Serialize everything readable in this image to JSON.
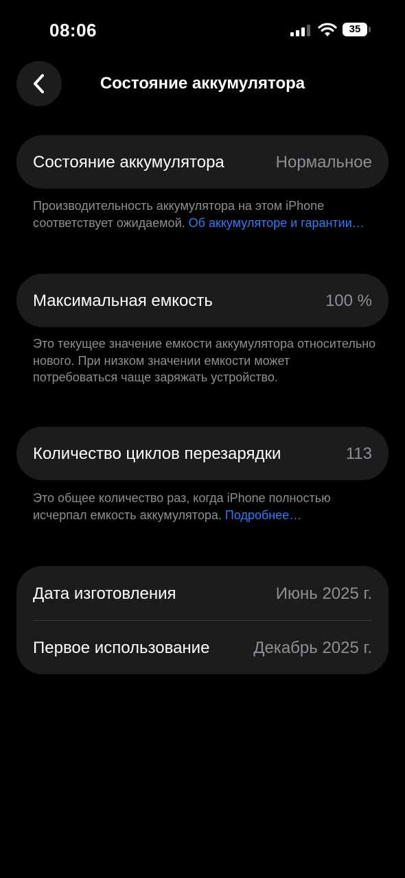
{
  "status_bar": {
    "time": "08:06",
    "battery_percent": "35",
    "signal_bars_active": 3,
    "signal_bars_total": 4
  },
  "nav": {
    "back_icon": "chevron-left-icon",
    "title": "Состояние аккумулятора"
  },
  "battery_health": {
    "label": "Состояние аккумулятора",
    "value": "Нормальное",
    "footnote": "Производительность аккумулятора на этом iPhone соответствует ожидаемой. ",
    "link": "Об аккумуляторе и гарантии…"
  },
  "max_capacity": {
    "label": "Максимальная емкость",
    "value": "100 %",
    "footnote": "Это текущее значение емкости аккумулятора относительно нового. При низком значении емкости может потребоваться чаще заряжать устройство."
  },
  "cycle_count": {
    "label": "Количество циклов перезарядки",
    "value": "113",
    "footnote": "Это общее количество раз, когда iPhone полностью исчерпал емкость аккумулятора. ",
    "link": "Подробнее…"
  },
  "dates": {
    "manufacture_label": "Дата изготовления",
    "manufacture_value": "Июнь 2025 г.",
    "first_use_label": "Первое использование",
    "first_use_value": "Декабрь 2025 г."
  },
  "colors": {
    "background": "#000000",
    "card": "#1c1c1e",
    "secondary_text": "#8e8e93",
    "link": "#2f7cf6"
  }
}
